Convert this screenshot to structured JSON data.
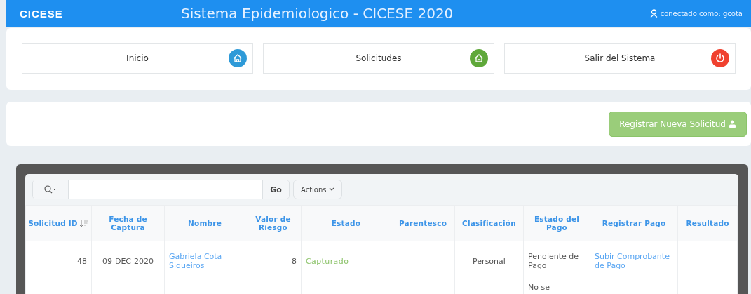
{
  "header": {
    "logo": "CICESE",
    "title": "Sistema Epidemiologico - CICESE 2020",
    "user": "conectado como: gcota"
  },
  "nav": [
    {
      "label": "Inicio",
      "kind": "home",
      "color": "#2e9ad8"
    },
    {
      "label": "Solicitudes",
      "kind": "home",
      "color": "#5fa83a"
    },
    {
      "label": "Salir del Sistema",
      "kind": "power",
      "color": "#f0412f"
    }
  ],
  "register_button": "Registrar Nueva Solicitud",
  "toolbar": {
    "go": "Go",
    "actions": "Actions"
  },
  "table": {
    "columns": [
      {
        "label": "Solicitud ID",
        "sorted": true
      },
      {
        "label": "Fecha de Captura",
        "sorted": false
      },
      {
        "label": "Nombre",
        "sorted": false
      },
      {
        "label": "Valor de Riesgo",
        "sorted": false
      },
      {
        "label": "Estado",
        "sorted": false
      },
      {
        "label": "Parentesco",
        "sorted": false
      },
      {
        "label": "Clasificación",
        "sorted": false
      },
      {
        "label": "Estado del Pago",
        "sorted": false
      },
      {
        "label": "Registrar Pago",
        "sorted": false
      },
      {
        "label": "Resultado",
        "sorted": false
      }
    ],
    "rows": [
      {
        "cells": [
          {
            "text": "48",
            "kind": "num"
          },
          {
            "text": "09-DEC-2020",
            "kind": "center"
          },
          {
            "text": "Gabriela Cota Siqueiros",
            "kind": "link"
          },
          {
            "text": "8",
            "kind": "num"
          },
          {
            "text": "Capturado",
            "kind": "status"
          },
          {
            "text": "-",
            "kind": "plain"
          },
          {
            "text": "Personal",
            "kind": "center"
          },
          {
            "text": "Pendiente de Pago",
            "kind": "plain"
          },
          {
            "text": "Subir Comprobante de Pago",
            "kind": "link"
          },
          {
            "text": "-",
            "kind": "plain"
          }
        ]
      },
      {
        "cells": [
          {
            "kind": "num"
          },
          {
            "kind": "center"
          },
          {
            "kind": "link"
          },
          {
            "kind": "num"
          },
          {
            "kind": "status"
          },
          {
            "kind": "plain"
          },
          {
            "kind": "center"
          },
          {
            "text": "No se",
            "kind": "plain"
          },
          {
            "kind": "link"
          },
          {
            "kind": "plain"
          }
        ]
      }
    ]
  }
}
